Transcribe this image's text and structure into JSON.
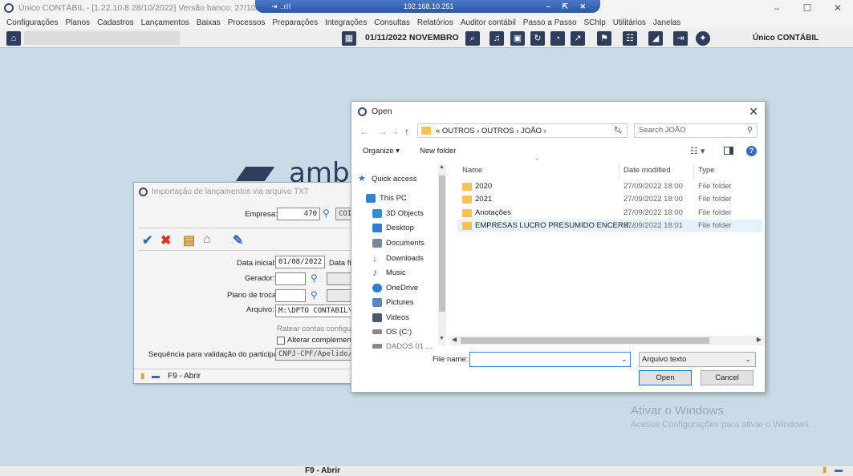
{
  "window": {
    "title": "Único CONTÁBIL - [1.22.10.8 28/10/2022] Versão banco: 27/10/2022 (07)",
    "controls": {
      "minimize": "–",
      "maximize": "☐",
      "close": "✕"
    }
  },
  "remote": {
    "left": "⇥ .ıll",
    "ip": "192.168.10.251",
    "right": "– ⇱ ✕"
  },
  "menu": [
    "Configurações",
    "Planos",
    "Cadastros",
    "Lançamentos",
    "Baixas",
    "Processos",
    "Preparações",
    "Integrações",
    "Consultas",
    "Relatórios",
    "Auditor contábil",
    "Passo a Passo",
    "SChlp",
    "Utilitários",
    "Janelas"
  ],
  "toolbar": {
    "date": "01/11/2022  NOVEMBRO",
    "company": "Único CONTÁBIL",
    "icons": [
      "search-icon",
      "bell-icon",
      "save-icon",
      "refresh-icon",
      "rss-icon",
      "export-icon",
      "flag-icon",
      "users-icon",
      "megaphone-icon",
      "exit-icon",
      "shield-icon"
    ]
  },
  "desktop": {
    "logo_text": "ambi",
    "watermark_title": "Ativar o Windows",
    "watermark_sub": "Acesse Configurações para ativar o Windows."
  },
  "statusbar": {
    "text": "F9 - Abrir"
  },
  "import_dialog": {
    "title": "Importação de lançamentos via arquivo TXT",
    "empresa_label": "Empresa:",
    "empresa_value": "470",
    "empresa_name": "COI",
    "data_inicial_label": "Data inicial:",
    "data_inicial_value": "01/08/2022",
    "data_final_label": "Data fi",
    "gerador_label": "Gerador:",
    "plano_label": "Plano de troca:",
    "arquivo_label": "Arquivo:",
    "arquivo_value": "M:\\DPTO CONTABIL\\",
    "ratear_label": "Ratear contas configurad",
    "alterar_label": "Alterar complemento p",
    "sequencia_label": "Sequência para validação do participante:",
    "sequencia_value": "CNPJ-CPF/Apelido/",
    "footer": "F9 - Abrir"
  },
  "open_dialog": {
    "title": "Open",
    "breadcrumb": "«  OUTROS  ›  OUTROS  ›  JOÃO  ›",
    "search_placeholder": "Search JOÃO",
    "organize_label": "Organize ▾",
    "new_folder_label": "New folder",
    "nav_items": [
      {
        "label": "Quick access",
        "color": "#2f6dbe"
      },
      {
        "label": "This PC",
        "color": "#3a7fc8"
      },
      {
        "label": "3D Objects",
        "color": "#2d8fd6"
      },
      {
        "label": "Desktop",
        "color": "#2f7dd0"
      },
      {
        "label": "Documents",
        "color": "#7a8799"
      },
      {
        "label": "Downloads",
        "color": "#2f6dbe"
      },
      {
        "label": "Music",
        "color": "#2f6dbe"
      },
      {
        "label": "OneDrive",
        "color": "#2f7dd0"
      },
      {
        "label": "Pictures",
        "color": "#5b86b8"
      },
      {
        "label": "Videos",
        "color": "#4b5a6a"
      },
      {
        "label": "OS (C:)",
        "color": "#888888"
      },
      {
        "label": "DADOS 01 ...",
        "color": "#888888"
      }
    ],
    "columns": {
      "name": "Name",
      "date": "Date modified",
      "type": "Type"
    },
    "files": [
      {
        "name": "2020",
        "date": "27/09/2022 18:00",
        "type": "File folder"
      },
      {
        "name": "2021",
        "date": "27/09/2022 18:00",
        "type": "File folder"
      },
      {
        "name": "Anotações",
        "date": "27/09/2022 18:00",
        "type": "File folder"
      },
      {
        "name": "EMPRESAS LUCRO PRESUMIDO ENCERR...",
        "date": "27/09/2022 18:01",
        "type": "File folder"
      }
    ],
    "file_name_label": "File name:",
    "file_name_value": "",
    "file_type_value": "Arquivo texto",
    "open_label": "Open",
    "cancel_label": "Cancel"
  }
}
